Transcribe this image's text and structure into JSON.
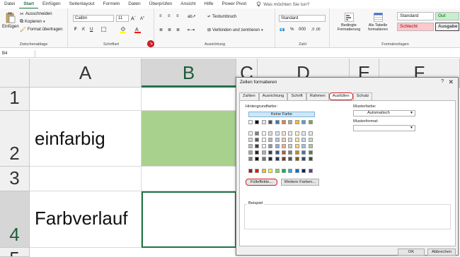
{
  "ribbon_tabs": [
    "Datei",
    "Start",
    "Einfügen",
    "Seitenlayout",
    "Formeln",
    "Daten",
    "Überprüfen",
    "Ansicht",
    "Hilfe",
    "Power Pivot"
  ],
  "tell_me": "Was möchten Sie tun?",
  "clipboard": {
    "paste": "Einfügen",
    "cut": "Ausschneiden",
    "copy": "Kopieren",
    "format_painter": "Format übertragen",
    "label": "Zwischenablage"
  },
  "font": {
    "name": "Calibri",
    "size": "11",
    "label": "Schriftart",
    "bold": "F",
    "italic": "K",
    "underline": "U"
  },
  "alignment": {
    "wrap": "Textumbruch",
    "merge": "Verbinden und zentrieren",
    "label": "Ausrichtung"
  },
  "number": {
    "format": "Standard",
    "label": "Zahl"
  },
  "styles_group": {
    "conditional": "Bedingte Formatierung",
    "as_table": "Als Tabelle formatieren",
    "label": "Formatvorlagen",
    "cells": [
      "Standard",
      "Gut",
      "Schlecht",
      "Ausgabe"
    ]
  },
  "name_box": "B4",
  "sheet": {
    "columns": [
      "A",
      "B",
      "C",
      "D",
      "E",
      "F"
    ],
    "rows": [
      "1",
      "2",
      "3",
      "4",
      "5"
    ],
    "a2": "einfarbig",
    "a4": "Farbverlauf"
  },
  "dialog": {
    "title": "Zellen formatieren",
    "help": "?",
    "close": "✕",
    "tabs": [
      "Zahlen",
      "Ausrichtung",
      "Schrift",
      "Rahmen",
      "Ausfüllen",
      "Schutz"
    ],
    "background_color_label": "Hintergrundfarbe:",
    "no_color": "Keine Farbe",
    "fill_effects": "Fülleffekte...",
    "more_colors": "Weitere Farben...",
    "pattern_color_label": "Musterfarbe:",
    "pattern_color_value": "Automatisch",
    "pattern_style_label": "Musterformat:",
    "pattern_style_value": "",
    "sample_label": "Beispiel",
    "ok": "OK",
    "cancel": "Abbrechen"
  },
  "colors": {
    "accent": "#217346",
    "highlight": "#d81f26",
    "b2_fill": "#a9d18e",
    "theme_top": [
      "#ffffff",
      "#000000",
      "#e7e6e6",
      "#44546a",
      "#4472c4",
      "#ed7d31",
      "#a5a5a5",
      "#ffc000",
      "#5b9bd5",
      "#70ad47"
    ],
    "standard": [
      "#c00000",
      "#ff0000",
      "#ffc000",
      "#ffff00",
      "#92d050",
      "#00b050",
      "#00b0f0",
      "#0070c0",
      "#002060",
      "#7030a0"
    ]
  }
}
